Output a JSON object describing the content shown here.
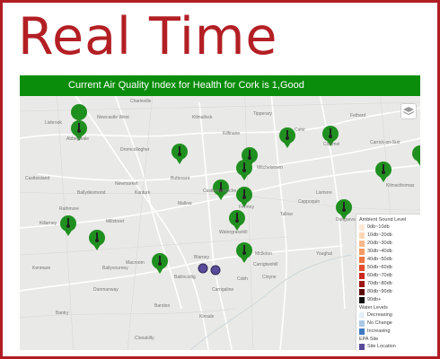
{
  "page": {
    "heading": "Real Time"
  },
  "map": {
    "aqi_banner": "Current Air Quality Index for Health for Cork is 1,Good",
    "layers_icon": "layers-icon",
    "station_marker_icon": "thermometer-pin-icon",
    "place_labels": [
      "Charleville",
      "Kilmallock",
      "Tipperary",
      "Cahir",
      "Fethard",
      "Newcastle West",
      "Lisbrook",
      "Abbeyfeale",
      "Kilfinane",
      "Mitchelstown",
      "Clonmel",
      "Carrick-on-Suir",
      "Castleisland",
      "Dromcollogher",
      "Buttevant",
      "Kanturk",
      "Mallow",
      "Fermoy",
      "Lismore",
      "Cappoquin",
      "Dungarvan",
      "Kilmacthomas",
      "Millstreet",
      "Macroom",
      "Youghal",
      "Killarney",
      "Blarney",
      "Carrigtwohill",
      "Cobh",
      "Cloyne",
      "Ballincollig",
      "Carrigaline",
      "Bandon",
      "Kinsale",
      "Dunmanway",
      "Clonakilty",
      "Bantry",
      "Kenmare",
      "Ballydesmond",
      "Newmarket",
      "Castletownroche",
      "Rathmore",
      "Ballyvourney",
      "Tallow",
      "Watergrasshill",
      "Midleton"
    ],
    "legend": {
      "sound_title": "Ambient Sound Level",
      "sound_levels": [
        {
          "label": "0db~10db",
          "color": "#fde8d4"
        },
        {
          "label": "10db~20db",
          "color": "#fbd6b6"
        },
        {
          "label": "20db~30db",
          "color": "#f8b98a"
        },
        {
          "label": "30db~40db",
          "color": "#f49a63"
        },
        {
          "label": "40db~50db",
          "color": "#ee7442"
        },
        {
          "label": "50db~60db",
          "color": "#e34d2c"
        },
        {
          "label": "60db~70db",
          "color": "#c9291e"
        },
        {
          "label": "70db~80db",
          "color": "#9e1515"
        },
        {
          "label": "80db~90db",
          "color": "#5e0909"
        },
        {
          "label": "90db+",
          "color": "#111111"
        }
      ],
      "water_title": "Water Levels",
      "water_levels": [
        {
          "label": "Decreasing",
          "color": "#e7f0f8"
        },
        {
          "label": "No Change",
          "color": "#a9c8e6"
        },
        {
          "label": "Increasing",
          "color": "#3f79c1"
        }
      ],
      "epa_title": "EPA Site",
      "epa_site": {
        "label": "Site Location",
        "color": "#5a4c9a"
      }
    }
  }
}
